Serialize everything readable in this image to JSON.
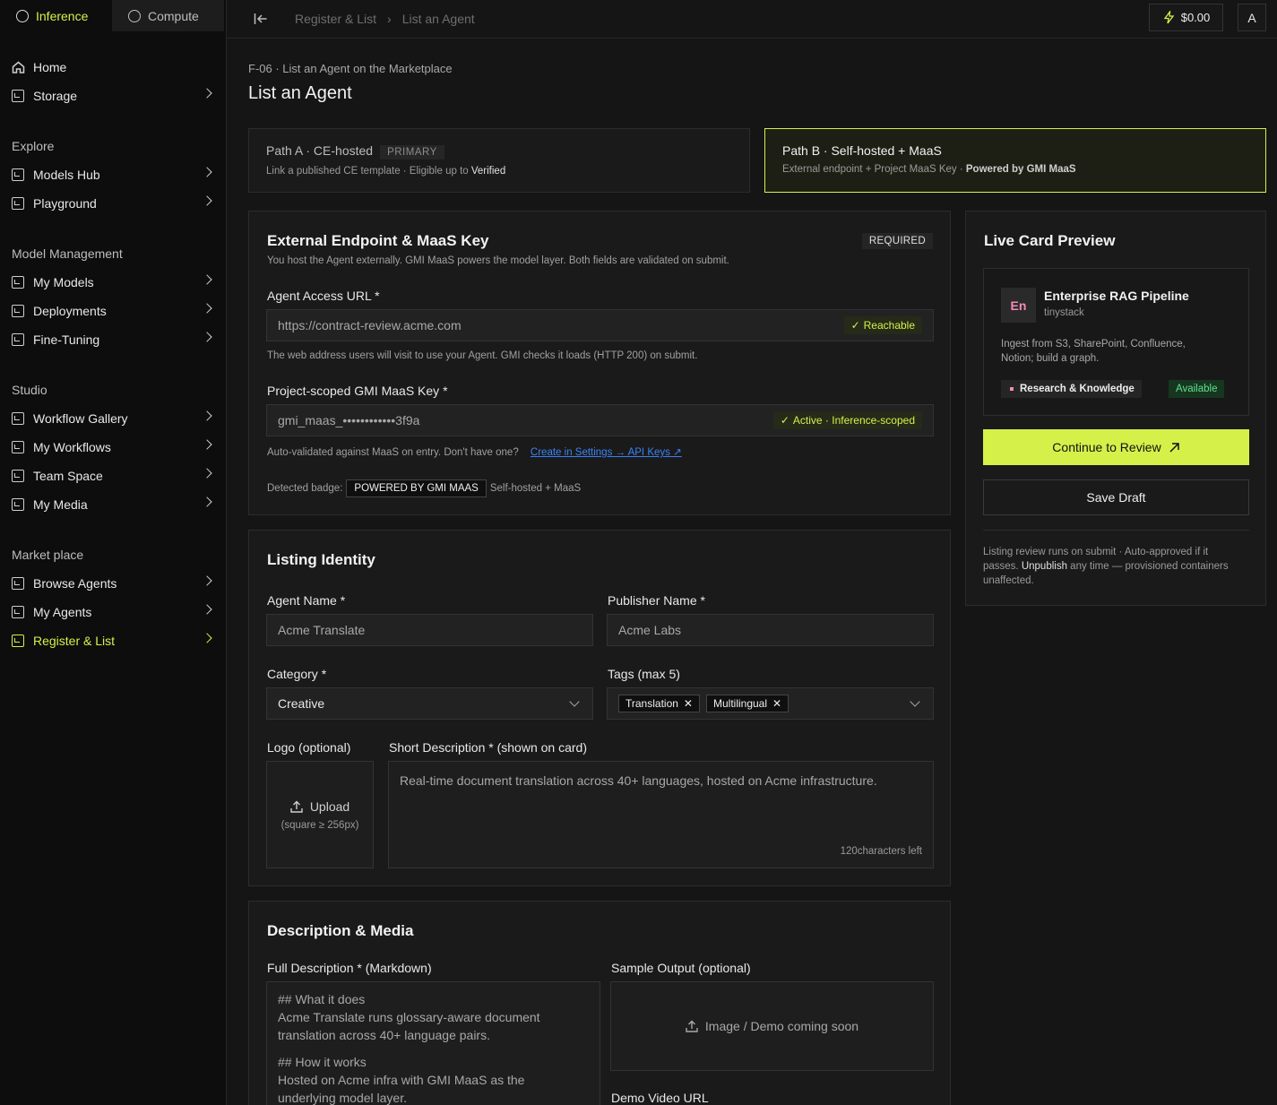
{
  "top_tabs": [
    {
      "label": "Inference"
    },
    {
      "label": "Compute"
    }
  ],
  "nav": {
    "home": "Home",
    "storage": "Storage",
    "explore_title": "Explore",
    "models_hub": "Models Hub",
    "playground": "Playground",
    "mm_title": "Model Management",
    "my_models": "My Models",
    "deployments": "Deployments",
    "fine_tuning": "Fine-Tuning",
    "studio_title": "Studio",
    "workflow_gallery": "Workflow Gallery",
    "my_workflows": "My Workflows",
    "team_space": "Team Space",
    "my_media": "My Media",
    "market_title": "Market place",
    "browse_agents": "Browse Agents",
    "my_agents": "My Agents",
    "register_list": "Register & List"
  },
  "header": {
    "crumb1": "Register & List",
    "crumb2": "List an Agent",
    "credit": "$0.00",
    "avatar": "A"
  },
  "page": {
    "subtitle": "F-06 · List an Agent on the Marketplace",
    "title": "List an Agent"
  },
  "path_a": {
    "title": "Path A · CE-hosted",
    "tag": "PRIMARY",
    "desc": "Link a published CE template · Eligible up to ",
    "desc_b": "Verified"
  },
  "path_b": {
    "title": "Path B · Self-hosted + MaaS",
    "desc": "External endpoint + Project MaaS Key · ",
    "desc_b": "Powered by GMI MaaS"
  },
  "endpoint": {
    "title": "External Endpoint & MaaS Key",
    "required": "REQUIRED",
    "desc": "You host the Agent externally. GMI MaaS powers the model layer. Both fields are validated on submit.",
    "url_label": "Agent Access URL *",
    "url_value": "https://contract-review.acme.com",
    "url_status": "Reachable",
    "url_help": "The web address users will visit to use your Agent. GMI checks it loads (HTTP 200) on submit.",
    "key_label": "Project-scoped GMI MaaS Key *",
    "key_value": "gmi_maas_••••••••••••3f9a",
    "key_status": "Active · Inference-scoped",
    "key_help": "Auto-validated against MaaS on entry. Don't have one?",
    "key_link": "Create in Settings → API Keys ↗",
    "badge_label": "Detected badge:",
    "badge": "POWERED BY GMI MAAS",
    "badge_suffix": "Self-hosted + MaaS"
  },
  "identity": {
    "title": "Listing Identity",
    "agent_name_label": "Agent Name *",
    "agent_name": "Acme Translate",
    "publisher_label": "Publisher Name *",
    "publisher": "Acme Labs",
    "category_label": "Category *",
    "category": "Creative",
    "tags_label": "Tags (max 5)",
    "tags": [
      "Translation",
      "Multilingual"
    ],
    "logo_label": "Logo (optional)",
    "upload": "Upload",
    "upload_hint": "(square ≥ 256px)",
    "short_label": "Short Description * (shown on card)",
    "short_value": "Real-time document translation across 40+ languages, hosted on Acme infrastructure.",
    "chars_left": "120characters left"
  },
  "media": {
    "title": "Description & Media",
    "full_label": "Full Description * (Markdown)",
    "full_lines": [
      "## What it does",
      "Acme Translate runs glossary-aware document",
      "translation across 40+ language pairs.",
      "",
      "## How it works",
      "Hosted on Acme infra with GMI MaaS as the",
      "underlying model layer."
    ],
    "sample_label": "Sample Output (optional)",
    "sample_placeholder": "Image / Demo coming soon",
    "video_label": "Demo Video URL"
  },
  "preview": {
    "title": "Live Card Preview",
    "avatar": "En",
    "name": "Enterprise RAG Pipeline",
    "publisher": "tinystack",
    "desc_l1": "Ingest from S3, SharePoint, Confluence,",
    "desc_l2": "Notion; build a graph.",
    "category": "Research & Knowledge",
    "status": "Available",
    "continue": "Continue to Review",
    "save": "Save Draft",
    "note_l1": "Listing review runs on submit · Auto-approved if it",
    "note_l2a": "passes. ",
    "note_l2b": "Unpublish",
    "note_l2c": " any time — provisioned containers",
    "note_l3": "unaffected."
  },
  "colors": {
    "accent": "#d6f04a",
    "bg": "#151515",
    "link": "#3b82f6"
  }
}
